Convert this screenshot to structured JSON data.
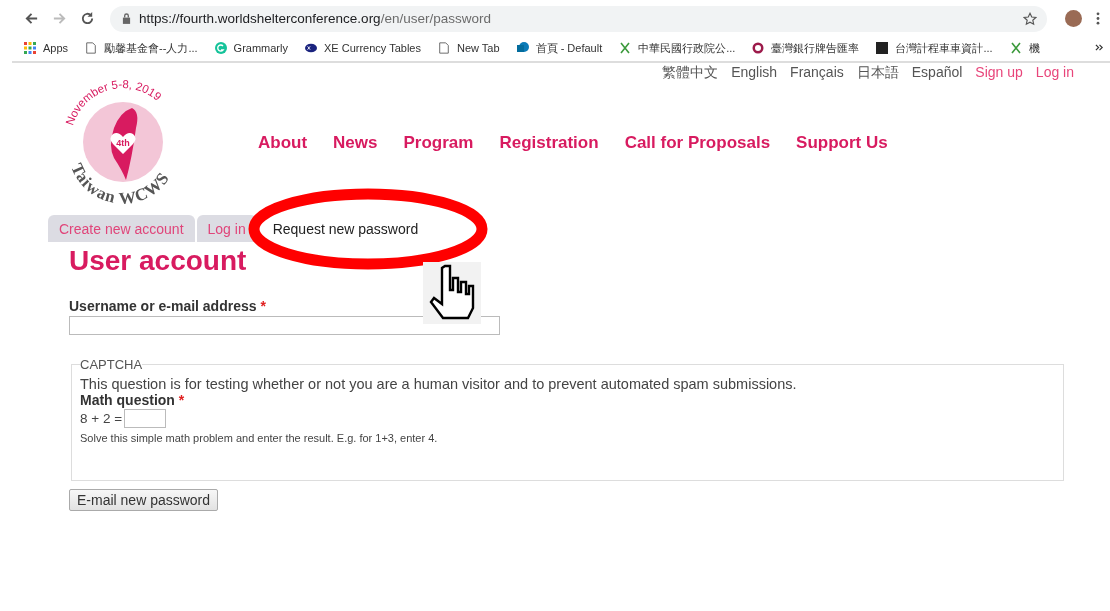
{
  "browser": {
    "url_host": "https://fourth.worldshelterconference.org",
    "url_path": "/en/user/password",
    "bookmarks": [
      {
        "label": "Apps",
        "kind": "apps"
      },
      {
        "label": "勵馨基金會--人力...",
        "kind": "page"
      },
      {
        "label": "Grammarly",
        "kind": "grammarly"
      },
      {
        "label": "XE Currency Tables",
        "kind": "xe"
      },
      {
        "label": "New Tab",
        "kind": "page"
      },
      {
        "label": "首頁 - Default",
        "kind": "sharepoint"
      },
      {
        "label": "中華民國行政院公...",
        "kind": "gov"
      },
      {
        "label": "臺灣銀行牌告匯率",
        "kind": "bank"
      },
      {
        "label": "台灣計程車車資計...",
        "kind": "dark"
      },
      {
        "label": "機",
        "kind": "gov"
      }
    ]
  },
  "top_links": [
    {
      "label": "繁體中文",
      "kind": "language"
    },
    {
      "label": "English",
      "kind": "language"
    },
    {
      "label": "Français",
      "kind": "language"
    },
    {
      "label": "日本語",
      "kind": "language"
    },
    {
      "label": "Español",
      "kind": "language"
    },
    {
      "label": "Sign up",
      "kind": "account"
    },
    {
      "label": "Log in",
      "kind": "account"
    }
  ],
  "logo": {
    "date": "November 5-8, 2019",
    "badge": "4th",
    "name": "Taiwan WCWS"
  },
  "nav": [
    "About",
    "News",
    "Program",
    "Registration",
    "Call for Proposals",
    "Support Us"
  ],
  "tabs": [
    {
      "label": "Create new account",
      "selected": false
    },
    {
      "label": "Log in",
      "selected": false
    },
    {
      "label": "Request new password",
      "selected": true
    }
  ],
  "title": "User account",
  "username": {
    "label": "Username or e-mail address",
    "required_mark": "*"
  },
  "captcha": {
    "legend": "CAPTCHA",
    "description": "This question is for testing whether or not you are a human visitor and to prevent automated spam submissions.",
    "label": "Math question",
    "required_mark": "*",
    "question": "8 + 2 =",
    "help": "Solve this simple math problem and enter the result. E.g. for 1+3, enter 4."
  },
  "submit": "E-mail new password"
}
